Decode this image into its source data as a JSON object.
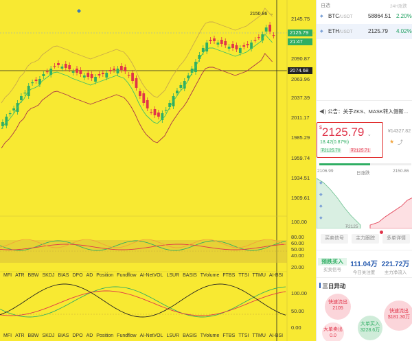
{
  "chart": {
    "y_ticks": [
      "2145.75",
      "2118.37",
      "2090.87",
      "2063.96",
      "2037.39",
      "2011.17",
      "1985.29",
      "1959.74",
      "1934.51",
      "1909.61"
    ],
    "high_label": "2150.86",
    "crosshair_price": "2074.68",
    "last_price": "2125.79",
    "countdown": "21:47",
    "osc1_ticks": [
      "100.00",
      "80.00",
      "60.00",
      "50.00",
      "40.00",
      "20.00"
    ],
    "osc2_ticks": [
      "100.00",
      "50.00",
      "0.00"
    ],
    "indicators": [
      "MFI",
      "ATR",
      "BBW",
      "SKDJ",
      "BIAS",
      "DPO",
      "AD",
      "Position",
      "Fundflow",
      "AI-NetVOL",
      "LSUR",
      "BASIS",
      "TVolume",
      "FTBS",
      "TTSI",
      "TTMU",
      "AI-BSI"
    ],
    "colors": {
      "up": "#2fae63",
      "down": "#e0344a",
      "background": "#f8e932"
    }
  },
  "panel": {
    "tab_self": "自选",
    "tab_24h": "24H涨跌",
    "coins": [
      {
        "symbol": "BTC",
        "quote": "/USDT",
        "price": "58864.51",
        "change": "2.20%"
      },
      {
        "symbol": "ETH",
        "quote": "/USDT",
        "price": "2125.79",
        "change": "4.02%"
      }
    ],
    "notice": "公告：关于ZKS、MASK转入侧新...",
    "price_box": {
      "currency": "$",
      "price": "2125.79",
      "change": "18.42(0.87%)",
      "bid": "₮2125.70",
      "ask": "₮2125.71"
    },
    "other_price": "¥14327.82",
    "progress": {
      "low": "2106.99",
      "label": "日涨跌",
      "high": "2150.86",
      "fill_fraction": 0.55
    },
    "depth_price": "₮2125",
    "buttons": [
      "买卖信号",
      "主力跟踪",
      "多单详情"
    ],
    "stats": [
      {
        "value": "预跌买入",
        "label": "买卖信号"
      },
      {
        "value": "111.04万",
        "label": "今日关注度"
      },
      {
        "value": "221.72万",
        "label": "主力净流入"
      }
    ],
    "three_day_title": "三日异动",
    "bubbles": [
      {
        "title": "快速流出",
        "value": "2105"
      },
      {
        "title": "大单买入",
        "value": "3228.6万"
      },
      {
        "title": "快速流出",
        "value": "$181.30万"
      },
      {
        "title": "大单卖出",
        "value": "0.0"
      }
    ]
  }
}
